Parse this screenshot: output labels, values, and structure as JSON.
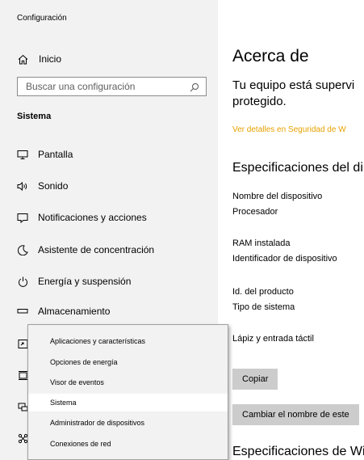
{
  "window": {
    "title": "Configuración"
  },
  "sidebar": {
    "home": {
      "label": "Inicio",
      "icon": "home-icon"
    },
    "search": {
      "placeholder": "Buscar una configuración",
      "icon": "search-icon"
    },
    "section": "Sistema",
    "items": [
      {
        "label": "Pantalla",
        "icon": "display-icon"
      },
      {
        "label": "Sonido",
        "icon": "speaker-icon"
      },
      {
        "label": "Notificaciones y acciones",
        "icon": "notification-icon"
      },
      {
        "label": "Asistente de concentración",
        "icon": "moon-icon"
      },
      {
        "label": "Energía y suspensión",
        "icon": "power-icon"
      },
      {
        "label": "Almacenamiento",
        "icon": "storage-icon"
      }
    ],
    "partial_icons": [
      "tablet-icon",
      "multitasking-icon",
      "projecting-icon",
      "shared-experiences-icon"
    ]
  },
  "main": {
    "title": "Acerca de",
    "status_line1": "Tu equipo está supervi",
    "status_line2": "protegido.",
    "security_link": "Ver detalles en Seguridad de W",
    "device_specs_heading": "Especificaciones del di",
    "labels": {
      "device_name": "Nombre del dispositivo",
      "processor": "Procesador",
      "ram": "RAM instalada",
      "device_id": "Identificador de dispositivo",
      "product_id": "Id. del producto",
      "system_type": "Tipo de sistema",
      "pen_touch": "Lápiz y entrada táctil"
    },
    "copy_button": "Copiar",
    "rename_button": "Cambiar el nombre de este",
    "windows_specs_heading": "Especificaciones de Wi"
  },
  "context_menu": {
    "items": [
      "Aplicaciones y características",
      "Opciones de energía",
      "Visor de eventos",
      "Sistema",
      "Administrador de dispositivos",
      "Conexiones de red"
    ],
    "highlighted": "Sistema"
  },
  "colors": {
    "sidebar_bg": "#f2f2f2",
    "link": "#e8a100",
    "button_bg": "#cccccc"
  }
}
